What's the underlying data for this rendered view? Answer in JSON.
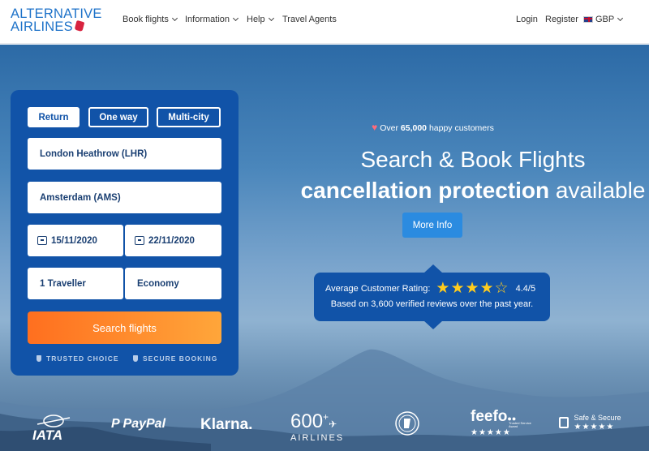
{
  "brand": {
    "line1": "ALTERNATIVE",
    "line2": "AIRLINES"
  },
  "nav": {
    "book_flights": "Book flights",
    "information": "Information",
    "help": "Help",
    "travel_agents": "Travel Agents",
    "login": "Login",
    "register": "Register",
    "currency": "GBP"
  },
  "trip_types": {
    "return": "Return",
    "one_way": "One way",
    "multi_city": "Multi-city",
    "selected": "Return"
  },
  "search": {
    "origin": "London Heathrow (LHR)",
    "destination": "Amsterdam (AMS)",
    "depart_date": "15/11/2020",
    "return_date": "22/11/2020",
    "travellers": "1 Traveller",
    "cabin": "Economy",
    "search_label": "Search flights",
    "trusted": "TRUSTED CHOICE",
    "secure": "SECURE BOOKING"
  },
  "hero": {
    "happy_prefix": "Over",
    "happy_count": "65,000",
    "happy_suffix": "happy customers",
    "title": "Search & Book Flights",
    "subtitle_bold": "cancellation protection",
    "subtitle_rest": "available",
    "more_info": "More Info"
  },
  "rating": {
    "label": "Average Customer Rating:",
    "stars": 4.4,
    "score": "4.4/5",
    "reviews": "Based on 3,600 verified reviews over the past year."
  },
  "partners": {
    "iata": "IATA",
    "paypal": "PayPal",
    "klarna": "Klarna.",
    "count": "600",
    "count_sup": "+",
    "airlines": "AIRLINES",
    "feefo": "feefo",
    "feefo_small": "Trusted Service Award",
    "safe": "Safe & Secure"
  },
  "colors": {
    "brand_blue": "#1153a8",
    "accent_orange": "#ff8a2c",
    "more_info_blue": "#2b8be0",
    "star_yellow": "#ffcc1e"
  }
}
